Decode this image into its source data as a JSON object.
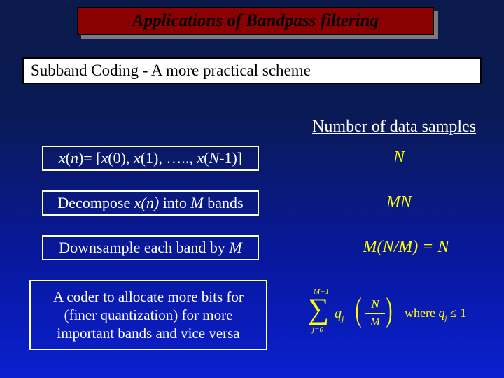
{
  "title": "Applications of Bandpass filtering",
  "subtitle": "Subband Coding - A more practical scheme",
  "column_header": "Number of data samples",
  "rows": {
    "r1": {
      "label_pre": "x",
      "label_mid": "(",
      "label_n": "n",
      "full": "x(n)= [x(0), x(1), ….., x(N-1)]",
      "value": "N"
    },
    "r2": {
      "full_a": "Decompose ",
      "full_b": "x(n)",
      "full_c": " into ",
      "full_d": "M",
      "full_e": " bands",
      "value": "MN"
    },
    "r3": {
      "full_a": "Downsample each band by ",
      "full_b": "M",
      "value_a": "M",
      "value_b": "(",
      "value_c": "N",
      "value_d": "/",
      "value_e": "M",
      "value_f": ") = ",
      "value_g": "N"
    },
    "r4": {
      "l1": "A coder to allocate more bits for",
      "l2": "(finer quantization) for more",
      "l3": "important bands and vice versa"
    }
  },
  "formula": {
    "sigma_top": "M−1",
    "sigma_bot": "j=0",
    "q": "q",
    "j": "j",
    "num": "N",
    "den": "M",
    "where_text": "where ",
    "where_q": "q",
    "where_j": "j",
    "where_rel": " ≤ 1"
  }
}
